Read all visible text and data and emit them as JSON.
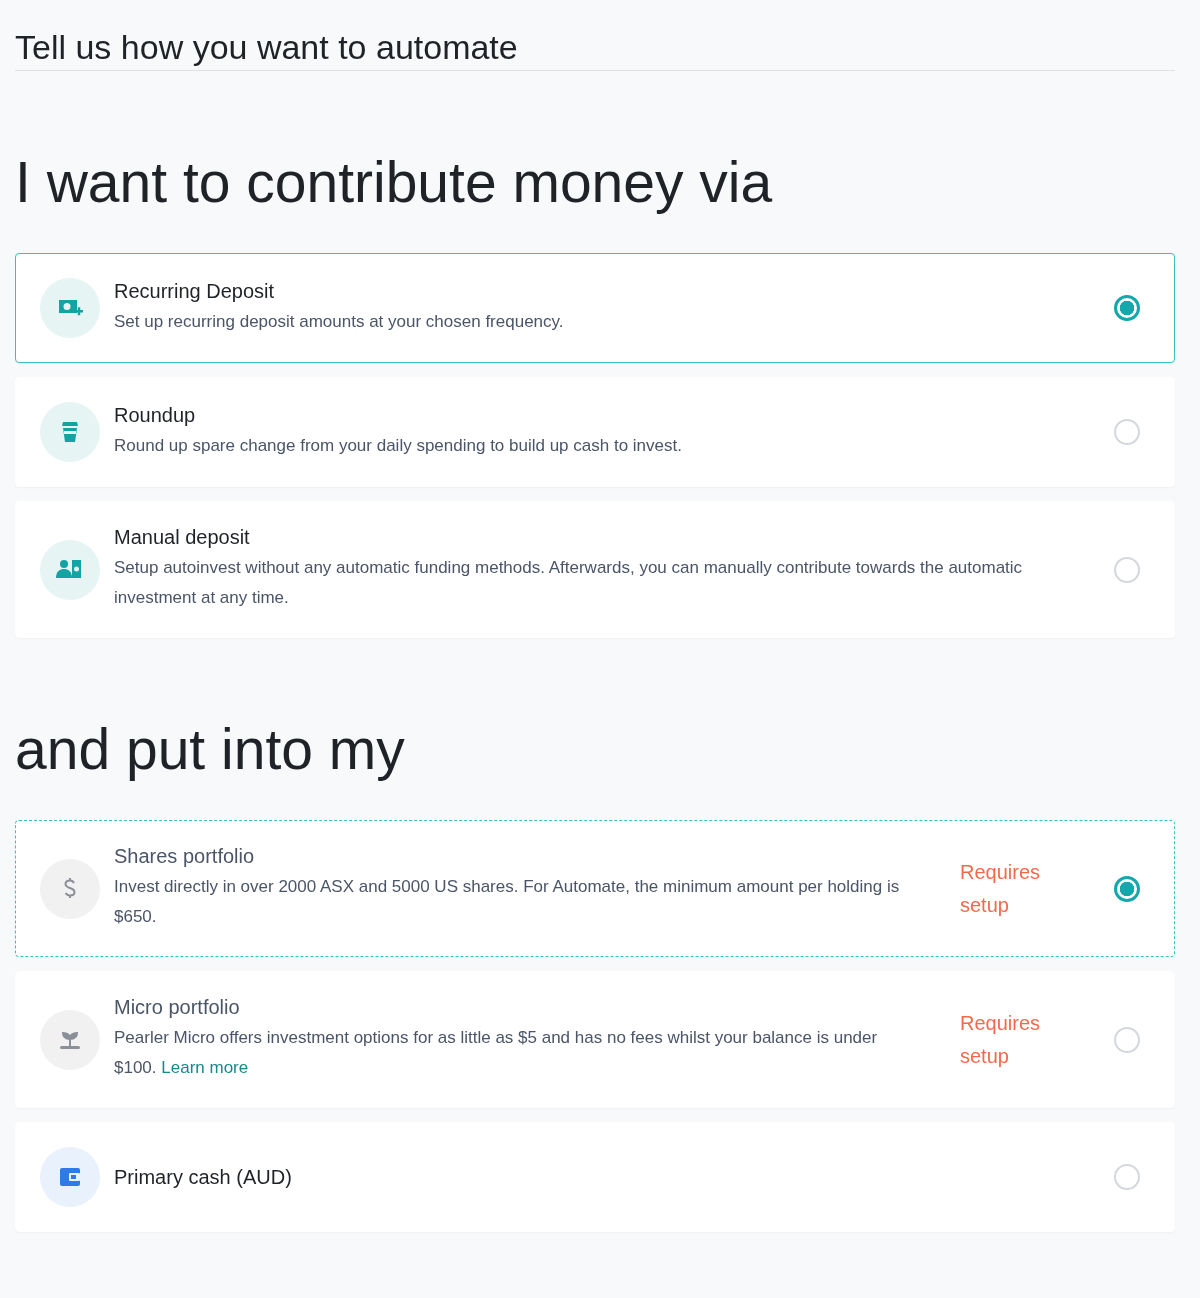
{
  "page_title": "Tell us how you want to automate",
  "sections": [
    {
      "heading": "I want to contribute money via",
      "options": [
        {
          "title": "Recurring Deposit",
          "description": "Set up recurring deposit amounts at your chosen frequency.",
          "selected": true
        },
        {
          "title": "Roundup",
          "description": "Round up spare change from your daily spending to build up cash to invest.",
          "selected": false
        },
        {
          "title": "Manual deposit",
          "description": "Setup autoinvest without any automatic funding methods. Afterwards, you can manually contribute towards the automatic investment at any time.",
          "selected": false
        }
      ]
    },
    {
      "heading": "and put into my",
      "options": [
        {
          "title": "Shares portfolio",
          "description": "Invest directly in over 2000 ASX and 5000 US shares. For Automate, the minimum amount per holding is $650.",
          "status": "Requires setup",
          "selected": true
        },
        {
          "title": "Micro portfolio",
          "description": "Pearler Micro offers investment options for as little as $5 and has no fees whilst your balance is under $100.",
          "link": "Learn more",
          "status": "Requires setup",
          "selected": false
        },
        {
          "title": "Primary cash (AUD)",
          "selected": false
        }
      ]
    }
  ]
}
